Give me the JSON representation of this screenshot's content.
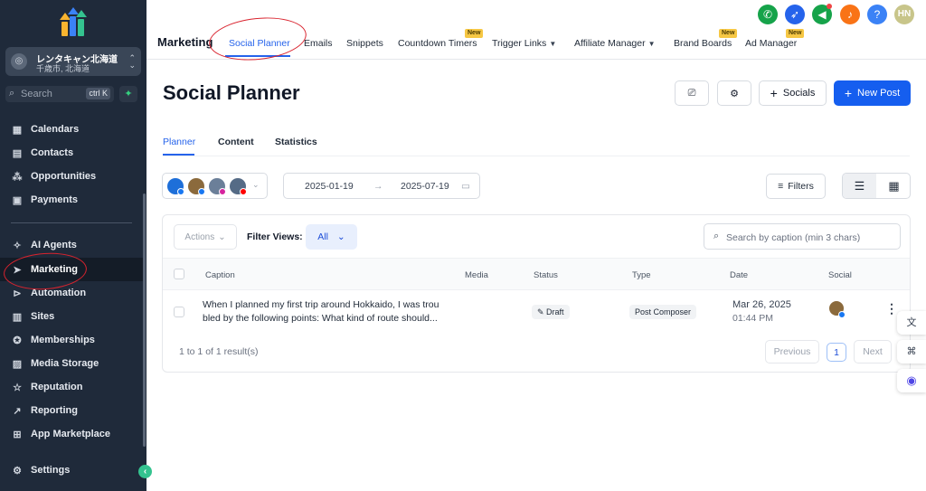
{
  "account": {
    "name": "レンタキャン北海道",
    "location": "千歳市, 北海道"
  },
  "search": {
    "placeholder": "Search",
    "shortcut": "ctrl K"
  },
  "sidebar": {
    "items": [
      {
        "label": "Calendars",
        "icon": "calendar-icon"
      },
      {
        "label": "Contacts",
        "icon": "contacts-icon"
      },
      {
        "label": "Opportunities",
        "icon": "opportunities-icon"
      },
      {
        "label": "Payments",
        "icon": "payments-icon"
      },
      {
        "label": "AI Agents",
        "icon": "sparkle-icon"
      },
      {
        "label": "Marketing",
        "icon": "send-icon"
      },
      {
        "label": "Automation",
        "icon": "automation-icon"
      },
      {
        "label": "Sites",
        "icon": "sites-icon"
      },
      {
        "label": "Memberships",
        "icon": "badge-icon"
      },
      {
        "label": "Media Storage",
        "icon": "image-icon"
      },
      {
        "label": "Reputation",
        "icon": "star-icon"
      },
      {
        "label": "Reporting",
        "icon": "chart-icon"
      },
      {
        "label": "App Marketplace",
        "icon": "grid-icon"
      }
    ],
    "settings": "Settings"
  },
  "topbar": {
    "section": "Marketing",
    "tabs": [
      "Social Planner",
      "Emails",
      "Snippets",
      "Countdown Timers",
      "Trigger Links",
      "Affiliate Manager",
      "Brand Boards",
      "Ad Manager"
    ],
    "new_badge": "New",
    "user_initials": "HN",
    "help": "?"
  },
  "page": {
    "title": "Social Planner",
    "socials_button": "Socials",
    "new_post_button": "New Post",
    "subtabs": [
      "Planner",
      "Content",
      "Statistics"
    ]
  },
  "filters": {
    "date_from": "2025-01-19",
    "date_to": "2025-07-19",
    "filters_button": "Filters",
    "actions": "Actions",
    "filter_views_label": "Filter Views:",
    "filter_views_value": "All",
    "caption_search_placeholder": "Search by caption (min 3 chars)"
  },
  "table": {
    "columns": [
      "Caption",
      "Media",
      "Status",
      "Type",
      "Date",
      "Social"
    ],
    "rows": [
      {
        "caption_line1": "When I planned my first trip around Hokkaido, I was trou",
        "caption_line2": "bled by the following points: What kind of route should...",
        "status": "Draft",
        "type": "Post Composer",
        "date": "Mar 26, 2025",
        "time": "01:44 PM"
      }
    ],
    "result_text": "1 to 1 of 1 result(s)",
    "prev": "Previous",
    "page": "1",
    "next": "Next"
  },
  "colors": {
    "sidebar_bg": "#1f2a3a",
    "primary": "#155eef",
    "annotation": "#d9232e"
  }
}
